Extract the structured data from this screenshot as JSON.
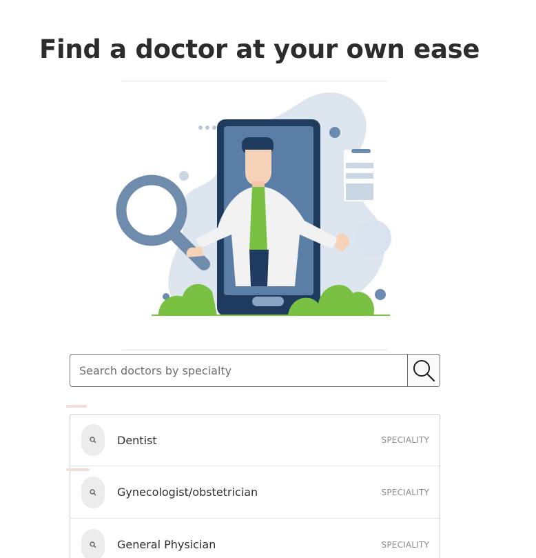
{
  "header": {
    "title": "Find a doctor at your own ease"
  },
  "illustration": {
    "icon": "doctor-on-phone-illustration"
  },
  "search": {
    "placeholder": "Search doctors by specialty",
    "value": "",
    "button_icon": "search-icon"
  },
  "results": [
    {
      "label": "Dentist",
      "tag": "SPECIALITY",
      "icon": "search-icon"
    },
    {
      "label": "Gynecologist/obstetrician",
      "tag": "SPECIALITY",
      "icon": "search-icon"
    },
    {
      "label": "General Physician",
      "tag": "SPECIALITY",
      "icon": "search-icon"
    }
  ],
  "colors": {
    "title": "#2c2c2c",
    "accent_blue": "#5d7ea2",
    "accent_green": "#7ac143",
    "blob": "#dde5ee"
  }
}
